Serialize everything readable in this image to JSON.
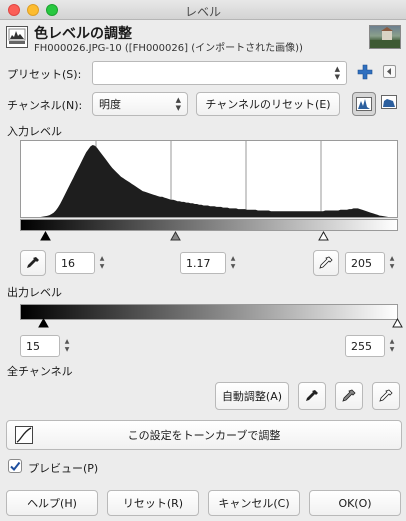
{
  "window": {
    "title": "レベル"
  },
  "header": {
    "title": "色レベルの調整",
    "subtitle": "FH000026.JPG-10 ([FH000026] (インポートされた画像))"
  },
  "presets": {
    "label": "プリセット(S):",
    "value": ""
  },
  "channel": {
    "label": "チャンネル(N):",
    "value": "明度",
    "reset_label": "チャンネルのリセット(E)"
  },
  "input_levels": {
    "label": "入力レベル",
    "low": "16",
    "gamma": "1.17",
    "high": "205"
  },
  "output_levels": {
    "label": "出力レベル",
    "low": "15",
    "high": "255"
  },
  "all_channels": {
    "label": "全チャンネル",
    "auto_label": "自動調整(A)"
  },
  "curves_button": {
    "label": "この設定をトーンカーブで調整"
  },
  "preview": {
    "label": "プレビュー(P)",
    "checked": true
  },
  "footer": {
    "help": "ヘルプ(H)",
    "reset": "リセット(R)",
    "cancel": "キャンセル(C)",
    "ok": "OK(O)"
  },
  "histogram": {
    "bins": [
      0,
      0,
      0,
      0,
      0,
      0,
      0,
      0,
      0,
      0,
      0.5,
      1,
      1.5,
      2.5,
      4,
      6,
      9,
      13,
      18,
      24,
      30,
      36,
      42,
      48,
      54,
      60,
      66,
      72,
      78,
      84,
      90,
      94,
      98,
      100,
      99,
      96,
      92,
      88,
      84,
      80,
      76,
      72,
      68,
      65,
      62,
      59,
      56,
      54,
      52,
      50,
      48,
      46,
      44,
      42,
      40,
      38,
      36,
      35,
      34,
      33,
      32,
      31,
      30,
      29,
      28,
      28,
      27,
      26,
      25,
      24,
      24,
      23,
      22,
      22,
      21,
      21,
      20,
      20,
      19,
      19,
      18,
      18,
      17,
      17,
      16,
      16,
      16,
      15,
      15,
      15,
      14,
      14,
      14,
      13,
      13,
      13,
      12,
      12,
      12,
      12,
      11,
      11,
      11,
      11,
      10,
      10,
      10,
      10,
      10,
      9,
      9,
      9,
      9,
      9,
      9,
      8,
      8,
      8,
      8,
      8,
      8,
      8,
      8,
      8,
      8,
      8,
      8,
      8,
      8,
      8,
      8,
      8,
      8,
      8,
      8,
      8,
      8,
      8,
      8,
      8,
      9,
      9,
      9,
      9,
      9,
      9,
      9,
      10,
      10,
      10,
      10,
      11,
      11,
      12,
      12,
      12,
      11,
      10,
      9,
      8,
      7,
      6,
      5,
      4,
      3,
      2,
      1.5,
      1,
      0.5,
      0,
      0,
      0,
      0,
      0
    ]
  },
  "colors": {
    "accent": "#1f78d6"
  }
}
